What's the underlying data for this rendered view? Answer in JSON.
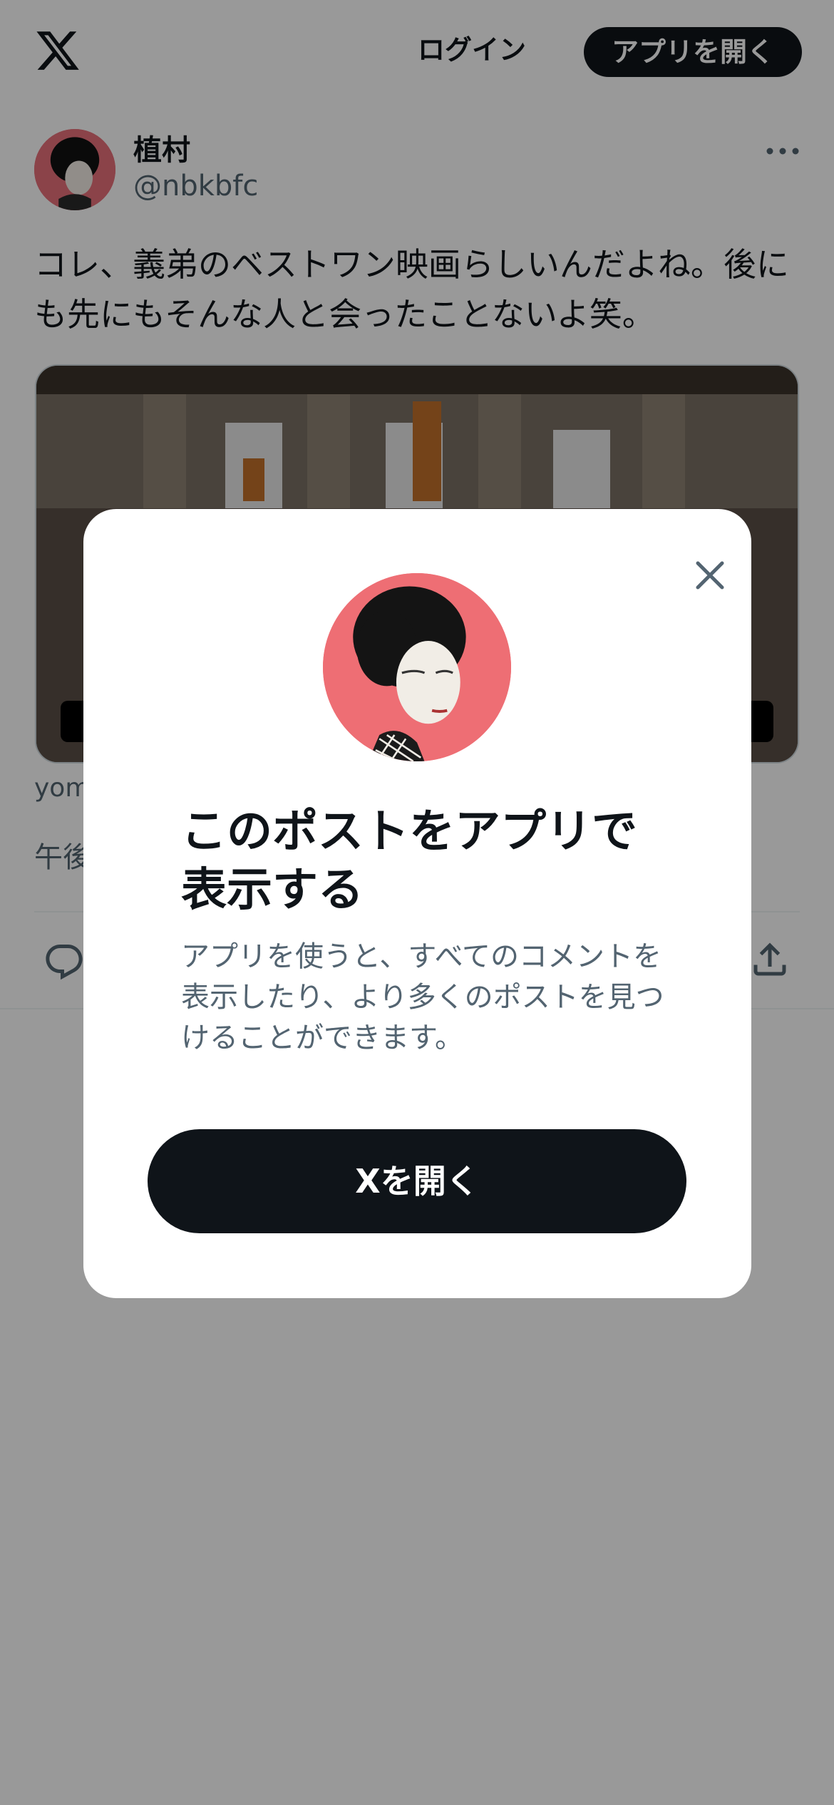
{
  "header": {
    "logo_icon": "x-logo-icon",
    "login_label": "ログイン",
    "open_app_label": "アプリを開く"
  },
  "post": {
    "author_name": "植村",
    "author_handle": "@nbkbfc",
    "text": "コレ、義弟のベストワン映画らしいんだよね。後にも先にもそんな人と会ったことないよ笑。",
    "source_partial": "yom",
    "time_partial": "午後"
  },
  "actions": {
    "reply_icon": "reply-icon",
    "share_icon": "share-icon",
    "more_icon": "more-icon"
  },
  "modal": {
    "title": "このポストをアプリで表示する",
    "description": "アプリを使うと、すべてのコメントを表示したり、より多くのポストを見つけることができます。",
    "cta_label": "Xを開く",
    "close_icon": "close-icon"
  },
  "colors": {
    "primary_dark": "#0f1419",
    "secondary_text": "#536471",
    "avatar_background": "#ee6e74",
    "overlay": "rgba(0,0,0,0.4)"
  }
}
